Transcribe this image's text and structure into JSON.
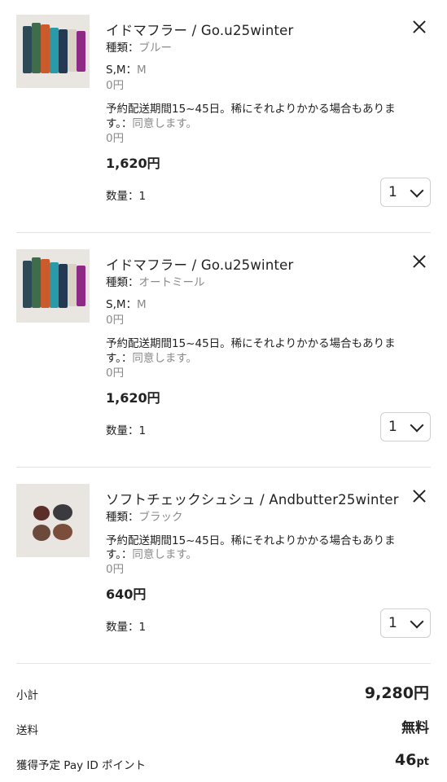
{
  "items": [
    {
      "title": "イドマフラー / Go.u25winter",
      "type_label": "種類：",
      "type_value": "ブルー",
      "size_label": "S,M：",
      "size_value": "M",
      "size_price": "0円",
      "reserve_line1": "予約配送期間15~45日。稀にそれよりかかる場合もありま",
      "reserve_line2": "す。：",
      "reserve_value": "同意します。",
      "reserve_price": "0円",
      "price": "1,620円",
      "qty_label": "数量：1",
      "qty_value": "1"
    },
    {
      "title": "イドマフラー / Go.u25winter",
      "type_label": "種類：",
      "type_value": "オートミール",
      "size_label": "S,M：",
      "size_value": "M",
      "size_price": "0円",
      "reserve_line1": "予約配送期間15~45日。稀にそれよりかかる場合もありま",
      "reserve_line2": "す。：",
      "reserve_value": "同意します。",
      "reserve_price": "0円",
      "price": "1,620円",
      "qty_label": "数量：1",
      "qty_value": "1"
    },
    {
      "title": "ソフトチェックシュシュ / Andbutter25winter",
      "type_label": "種類：",
      "type_value": "ブラック",
      "reserve_line1": "予約配送期間15~45日。稀にそれよりかかる場合もありま",
      "reserve_line2": "す。：",
      "reserve_value": "同意します。",
      "reserve_price": "0円",
      "price": "640円",
      "qty_label": "数量：1",
      "qty_value": "1"
    }
  ],
  "summary": {
    "subtotal_label": "小計",
    "subtotal_value": "9,280円",
    "shipping_label": "送料",
    "shipping_value": "無料",
    "points_label": "獲得予定 Pay ID ポイント",
    "points_value": "46",
    "points_unit": "pt"
  },
  "colors": {
    "text": "#222222",
    "muted": "#8a8a8a",
    "divider": "#e3e3e3",
    "border": "#cfcfcf"
  },
  "icons": {
    "remove": "close-icon",
    "dropdown": "chevron-down-icon"
  }
}
